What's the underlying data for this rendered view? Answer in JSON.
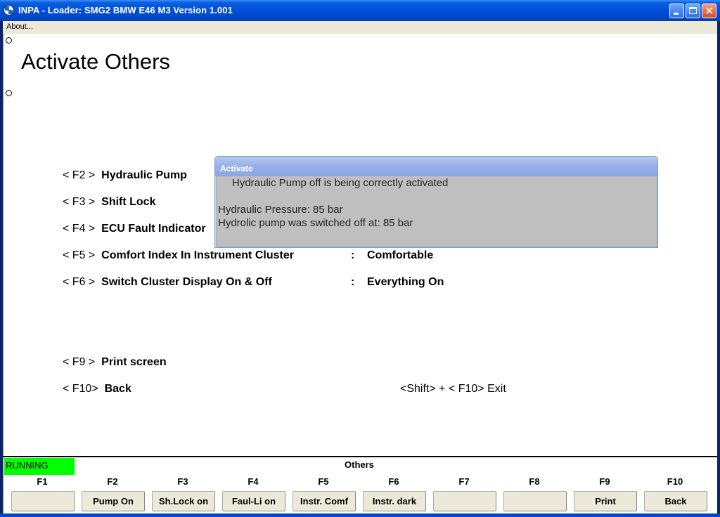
{
  "window": {
    "title": "INPA - Loader:  SMG2 BMW E46 M3 Version 1.001"
  },
  "menu": {
    "about": "About..."
  },
  "page": {
    "title": "Activate Others"
  },
  "rows": [
    {
      "key": "< F2 >",
      "label": "Hydraulic Pump",
      "colon": "",
      "value": ""
    },
    {
      "key": "< F3 >",
      "label": "Shift Lock",
      "colon": "",
      "value": ""
    },
    {
      "key": "< F4 >",
      "label": "ECU Fault Indicator",
      "colon": "",
      "value": ""
    },
    {
      "key": "< F5 >",
      "label": "Comfort Index In Instrument Cluster",
      "colon": ":",
      "value": "Comfortable"
    },
    {
      "key": "< F6 >",
      "label": "Switch Cluster Display On & Off",
      "colon": ":",
      "value": "Everything On"
    },
    {
      "key": "< F9 >",
      "label": "Print screen",
      "colon": "",
      "value": ""
    },
    {
      "key": "< F10>",
      "label": "Back",
      "colon": "",
      "value": ""
    }
  ],
  "exit": {
    "text": "<Shift> + < F10>  Exit"
  },
  "popup": {
    "title": "Activate",
    "line1": "Hydraulic Pump off is being correctly activated",
    "line2": "Hydraulic Pressure: 85 bar",
    "line3": "Hydrolic pump was switched off at: 85 bar"
  },
  "status": {
    "text": "RUNNING",
    "color": "#00ff00"
  },
  "screen_name": "Others",
  "fkeys": [
    {
      "key": "F1",
      "label": ""
    },
    {
      "key": "F2",
      "label": "Pump On"
    },
    {
      "key": "F3",
      "label": "Sh.Lock on"
    },
    {
      "key": "F4",
      "label": "Faul-Li on"
    },
    {
      "key": "F5",
      "label": "Instr. Comf"
    },
    {
      "key": "F6",
      "label": "Instr. dark"
    },
    {
      "key": "F7",
      "label": ""
    },
    {
      "key": "F8",
      "label": ""
    },
    {
      "key": "F9",
      "label": "Print"
    },
    {
      "key": "F10",
      "label": "Back"
    }
  ]
}
